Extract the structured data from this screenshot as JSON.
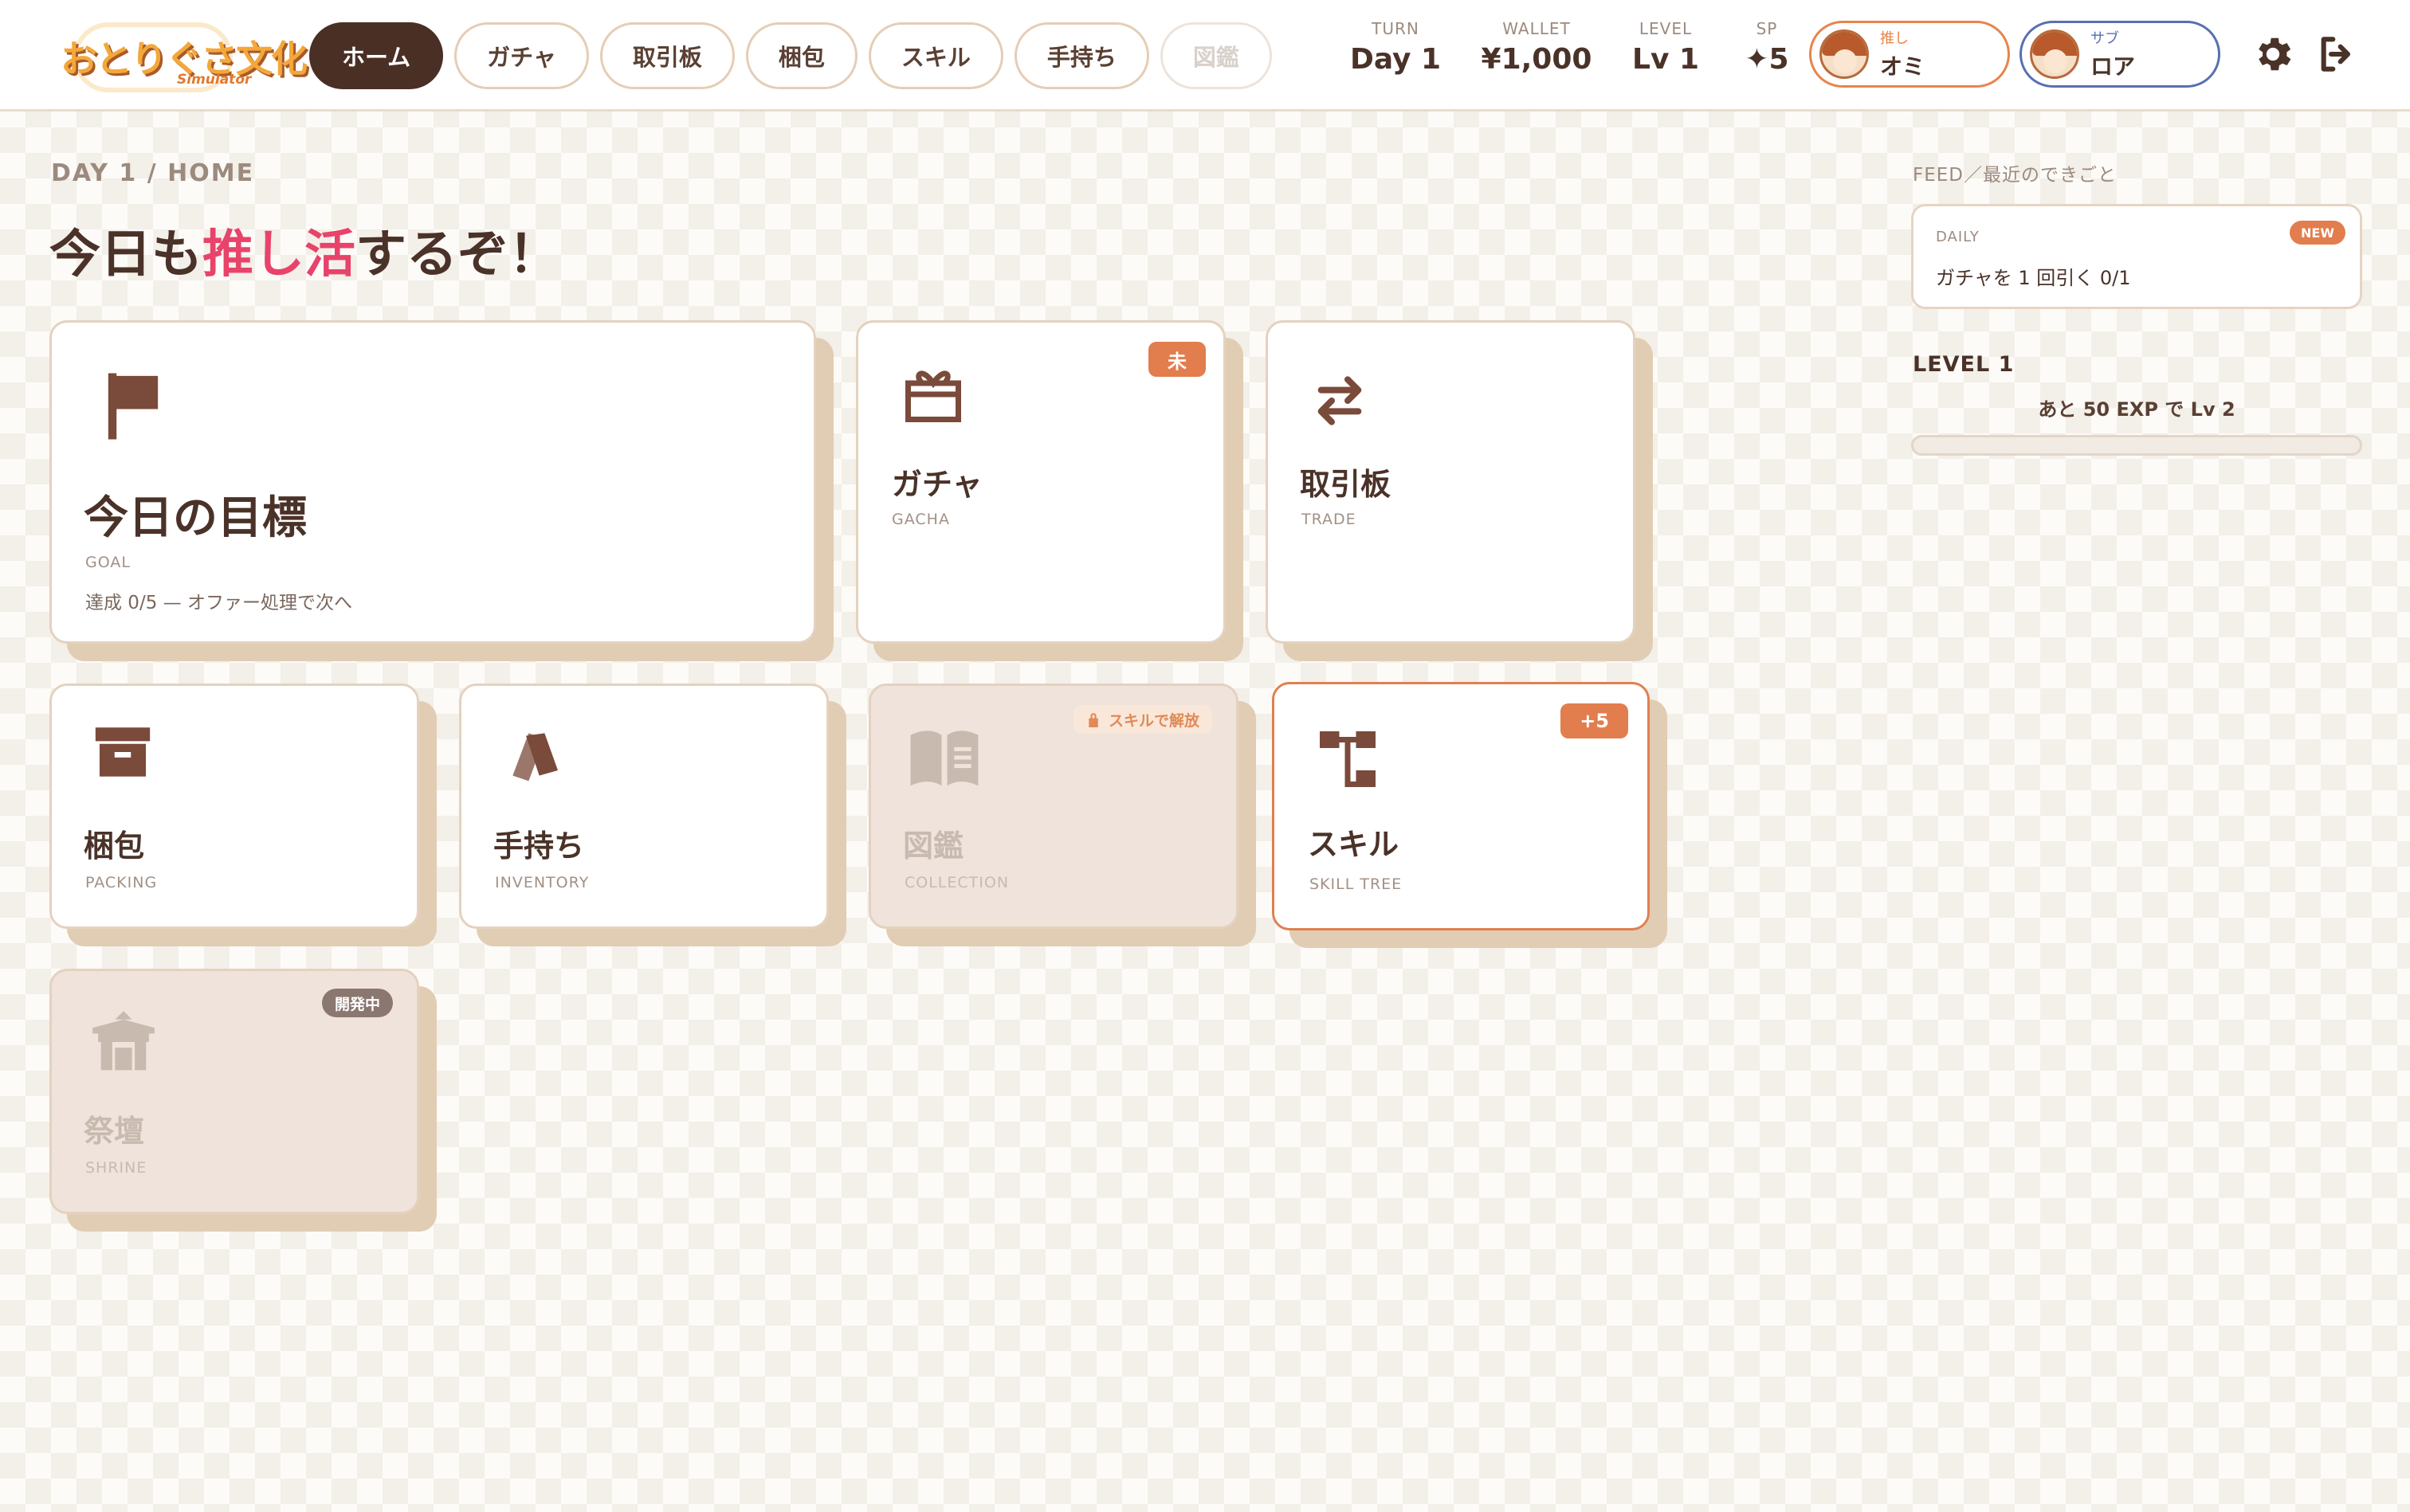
{
  "logo": {
    "title": "おとりぐさ文化",
    "sub": "Simulator"
  },
  "nav": {
    "tabs": [
      {
        "label": "ホーム",
        "state": "active"
      },
      {
        "label": "ガチャ",
        "state": "normal"
      },
      {
        "label": "取引板",
        "state": "normal"
      },
      {
        "label": "梱包",
        "state": "normal"
      },
      {
        "label": "スキル",
        "state": "normal"
      },
      {
        "label": "手持ち",
        "state": "normal"
      },
      {
        "label": "図鑑",
        "state": "disabled"
      }
    ]
  },
  "stats": {
    "turn": {
      "label": "TURN",
      "value": "Day 1"
    },
    "wallet": {
      "label": "WALLET",
      "value": "¥1,000"
    },
    "level": {
      "label": "LEVEL",
      "value": "Lv 1"
    },
    "sp": {
      "label": "SP",
      "value": "✦5"
    }
  },
  "chips": {
    "oshi": {
      "role": "推し",
      "name": "オミ"
    },
    "sub": {
      "role": "サブ",
      "name": "ロア"
    }
  },
  "icons": {
    "settings": "gear-icon",
    "logout": "logout-icon"
  },
  "main": {
    "breadcrumb": "DAY 1 / HOME",
    "headline_pre": "今日も",
    "headline_highlight": "推し活",
    "headline_post": "するぞ！"
  },
  "cards": {
    "goal": {
      "title": "今日の目標",
      "sub": "GOAL",
      "desc": "達成 0/5 — オファー処理で次へ"
    },
    "gacha": {
      "title": "ガチャ",
      "sub": "GACHA",
      "badge": "未"
    },
    "trade": {
      "title": "取引板",
      "sub": "TRADE"
    },
    "packing": {
      "title": "梱包",
      "sub": "PACKING"
    },
    "inventory": {
      "title": "手持ち",
      "sub": "INVENTORY"
    },
    "collection": {
      "title": "図鑑",
      "sub": "COLLECTION",
      "badge": "スキルで解放"
    },
    "skill": {
      "title": "スキル",
      "sub": "SKILL TREE",
      "badge": "+5"
    },
    "shrine": {
      "title": "祭壇",
      "sub": "SHRINE",
      "badge": "開発中"
    }
  },
  "sidebar": {
    "feed_label": "FEED／最近のできごと",
    "feed": {
      "tag": "DAILY",
      "badge": "NEW",
      "text": "ガチャを 1 回引く  0/1"
    },
    "level_title": "LEVEL 1",
    "level_next": "あと 50 EXP で Lv 2",
    "level_progress": 0
  },
  "colors": {
    "accent": "#e8436a",
    "brand_dark": "#4a2f25",
    "badge": "#e27d4e"
  }
}
